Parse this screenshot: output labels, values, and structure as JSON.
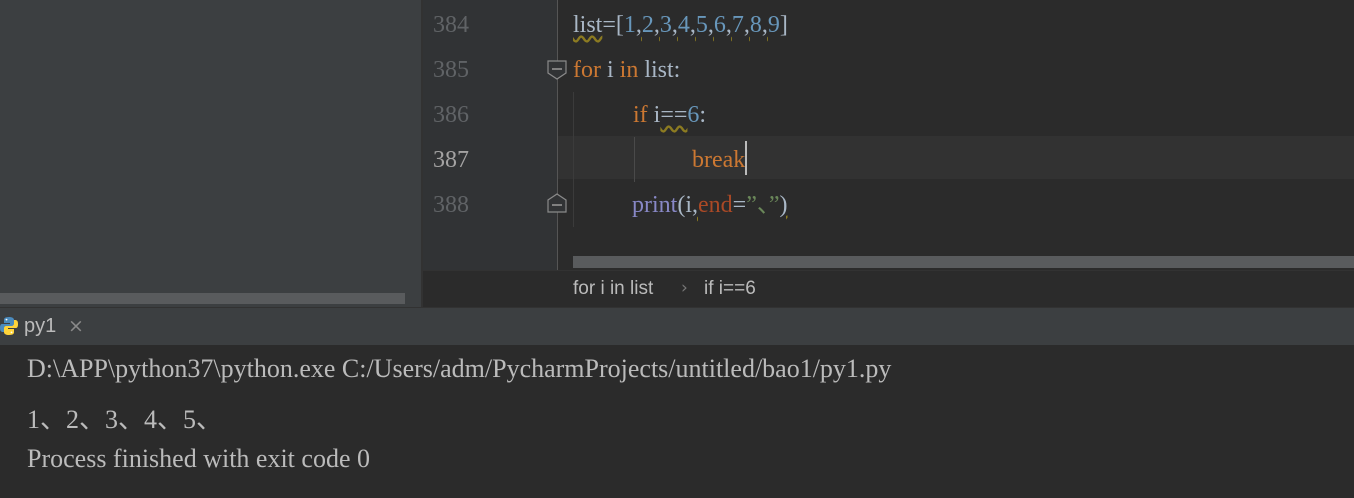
{
  "editor": {
    "line_numbers": [
      "384",
      "385",
      "386",
      "387",
      "388"
    ],
    "code": {
      "l384": {
        "list_ident": "list",
        "open": "=[",
        "nums": [
          "1",
          "2",
          "3",
          "4",
          "5",
          "6",
          "7",
          "8",
          "9"
        ],
        "comma": ",",
        "close": "]"
      },
      "l385": {
        "kw_for": "for",
        "var": " i ",
        "kw_in": "in",
        "rest": " list:"
      },
      "l386": {
        "kw_if": "if",
        "var": " i",
        "op": "==",
        "num": "6",
        "colon": ":"
      },
      "l387": {
        "kw_break": "break"
      },
      "l388": {
        "builtin_print": "print",
        "open": "(i",
        "comma": ",",
        "param_end": "end",
        "eq": "=",
        "str": "”、”",
        "close": ")"
      }
    }
  },
  "breadcrumb": {
    "items": [
      "for i in list",
      "if i==6"
    ],
    "separator": "›"
  },
  "run": {
    "tab_label": "py1",
    "close_glyph": "×",
    "console": {
      "command": "D:\\APP\\python37\\python.exe C:/Users/adm/PycharmProjects/untitled/bao1/py1.py",
      "output": "1、2、3、4、5、",
      "exit": "Process finished with exit code 0"
    }
  },
  "icons": [
    "fold-collapse-icon",
    "python-icon",
    "close-icon"
  ]
}
